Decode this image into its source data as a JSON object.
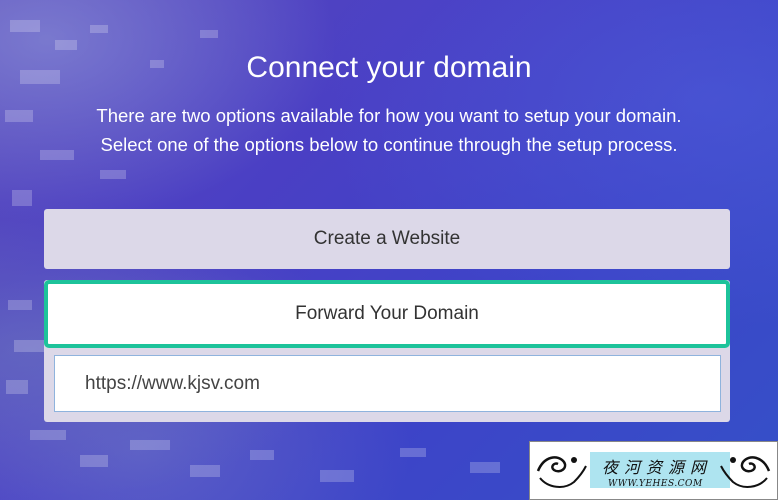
{
  "header": {
    "title": "Connect your domain",
    "subtitle_line1": "There are two options available for how you want to setup your domain.",
    "subtitle_line2": "Select one of the options below to continue through the setup process."
  },
  "options": {
    "create_label": "Create a Website",
    "forward_label": "Forward Your Domain"
  },
  "forward_input": {
    "value": "https://www.kjsv.com"
  },
  "watermark": {
    "chinese": "夜河资源网",
    "url": "WWW.YEHES.COM"
  },
  "colors": {
    "accent": "#1dc39a",
    "option_bg": "#dcd8e8",
    "background": "#4a3fc4"
  }
}
